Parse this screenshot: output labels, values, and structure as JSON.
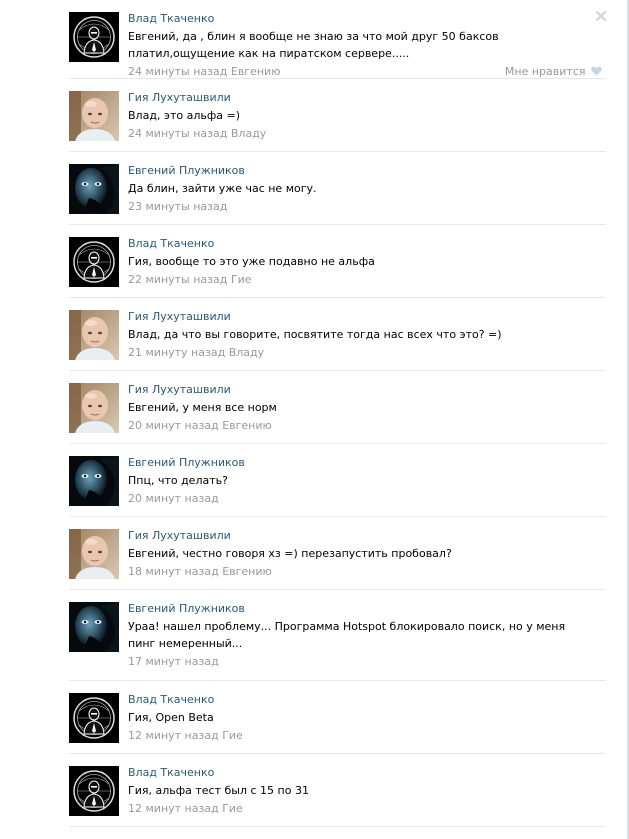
{
  "comments": [
    {
      "author": "Влад Ткаченко",
      "avatar": "anonymous",
      "text": "Евгений, да , блин я вообще не знаю за что мой друг 50 баксов платил,ощущение как на пиратском сервере.....",
      "time": "24 минуты назад",
      "reply_to": "Евгению",
      "like_label": "Мне нравится",
      "has_close": true
    },
    {
      "author": "Гия Лухуташвили",
      "avatar": "bald",
      "text": "Влад, это альфа =)",
      "time": "24 минуты назад",
      "reply_to": "Владу"
    },
    {
      "author": "Евгений Плужников",
      "avatar": "blue-face",
      "text": "Да блин, зайти уже час не могу.",
      "time": "23 минуты назад",
      "reply_to": ""
    },
    {
      "author": "Влад Ткаченко",
      "avatar": "anonymous",
      "text": "Гия, вообще то это уже подавно не альфа",
      "time": "22 минуты назад",
      "reply_to": "Гие"
    },
    {
      "author": "Гия Лухуташвили",
      "avatar": "bald",
      "text": "Влад, да что вы говорите, посвятите тогда нас всех что это? =)",
      "time": "21 минуту назад",
      "reply_to": "Владу"
    },
    {
      "author": "Гия Лухуташвили",
      "avatar": "bald",
      "text": "Евгений, у меня все норм",
      "time": "20 минут назад",
      "reply_to": "Евгению"
    },
    {
      "author": "Евгений Плужников",
      "avatar": "blue-face",
      "text": "Ппц, что делать?",
      "time": "20 минут назад",
      "reply_to": ""
    },
    {
      "author": "Гия Лухуташвили",
      "avatar": "bald",
      "text": "Евгений, честно говоря хз =) перезапустить пробовал?",
      "time": "18 минут назад",
      "reply_to": "Евгению"
    },
    {
      "author": "Евгений Плужников",
      "avatar": "blue-face",
      "text": "Ураа! нашел проблему... Программа Hotspot блокировало поиск, но у меня пинг немеренный...",
      "time": "17 минут назад",
      "reply_to": ""
    },
    {
      "author": "Влад Ткаченко",
      "avatar": "anonymous",
      "text": "Гия, Open Beta",
      "time": "12 минут назад",
      "reply_to": "Гие"
    },
    {
      "author": "Влад Ткаченко",
      "avatar": "anonymous",
      "text": "Гия, альфа тест был с 15 по 31",
      "time": "12 минут назад",
      "reply_to": "Гие"
    }
  ],
  "colors": {
    "author_link": "#2b587a",
    "meta": "#999999",
    "divider": "#e4e8ed"
  }
}
